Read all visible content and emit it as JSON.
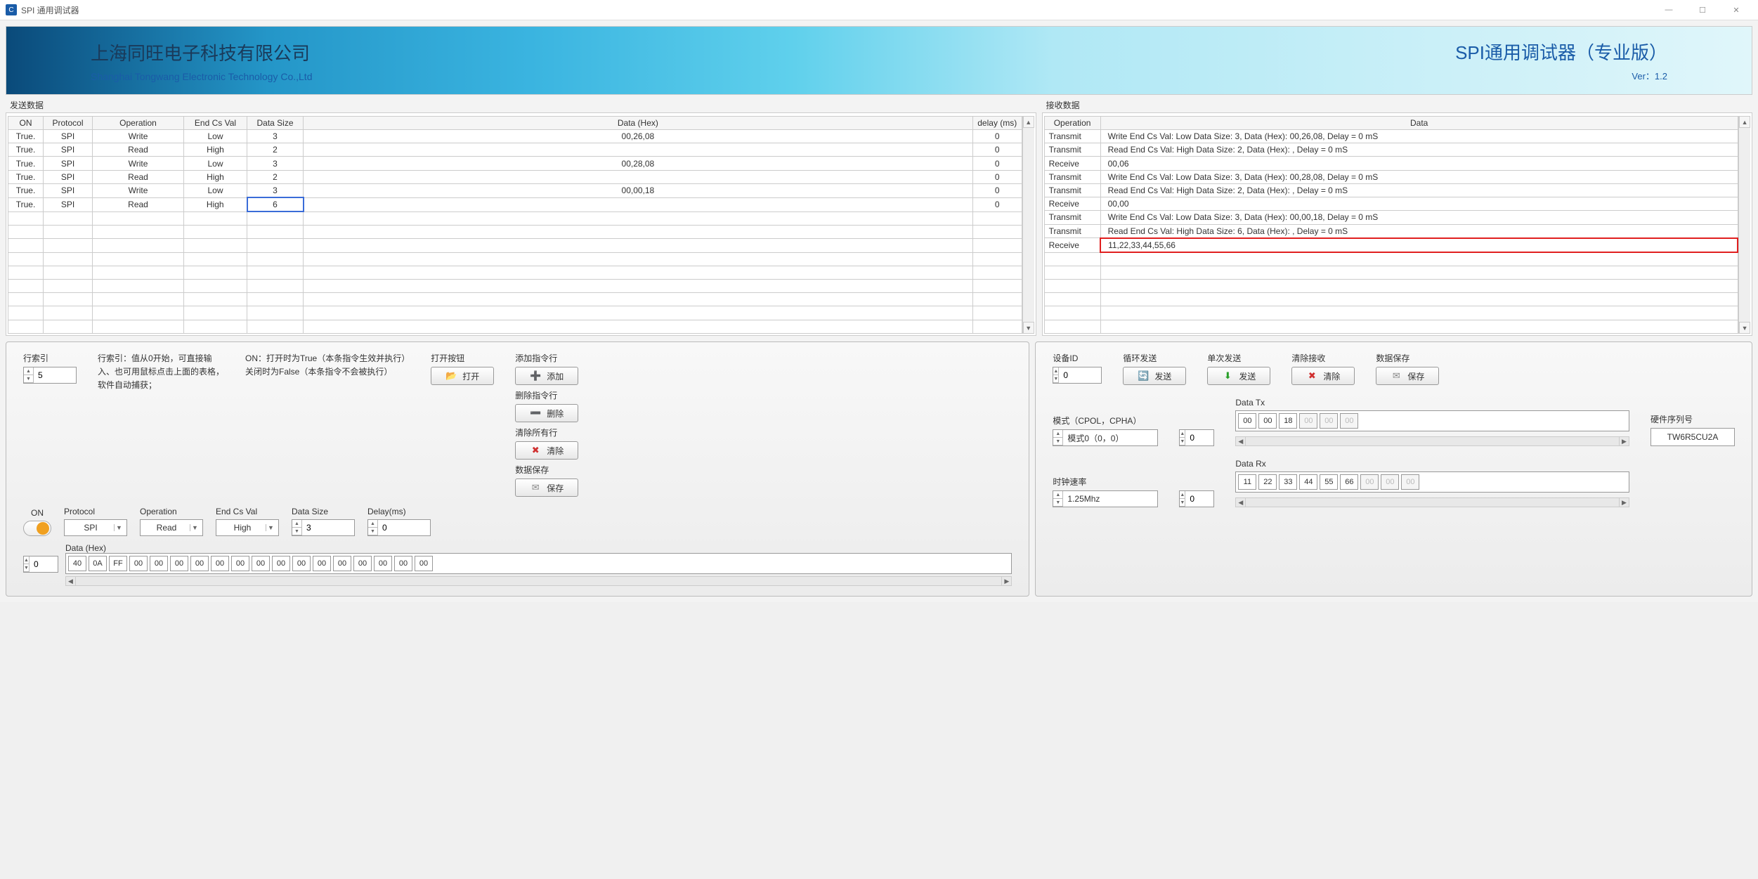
{
  "window": {
    "title": "SPI 通用调试器"
  },
  "banner": {
    "company_cn": "上海同旺电子科技有限公司",
    "company_en": "Shanghai Tongwang Electronic Technology Co.,Ltd",
    "product": "SPI通用调试器（专业版）",
    "version": "Ver：1.2"
  },
  "send": {
    "title": "发送数据",
    "headers": {
      "on": "ON",
      "protocol": "Protocol",
      "operation": "Operation",
      "endcs": "End Cs Val",
      "size": "Data Size",
      "data": "Data (Hex)",
      "delay": "delay (ms)"
    },
    "rows": [
      {
        "on": "True.",
        "protocol": "SPI",
        "operation": "Write",
        "endcs": "Low",
        "size": "3",
        "data": "00,26,08",
        "delay": "0"
      },
      {
        "on": "True.",
        "protocol": "SPI",
        "operation": "Read",
        "endcs": "High",
        "size": "2",
        "data": "",
        "delay": "0"
      },
      {
        "on": "True.",
        "protocol": "SPI",
        "operation": "Write",
        "endcs": "Low",
        "size": "3",
        "data": "00,28,08",
        "delay": "0"
      },
      {
        "on": "True.",
        "protocol": "SPI",
        "operation": "Read",
        "endcs": "High",
        "size": "2",
        "data": "",
        "delay": "0"
      },
      {
        "on": "True.",
        "protocol": "SPI",
        "operation": "Write",
        "endcs": "Low",
        "size": "3",
        "data": "00,00,18",
        "delay": "0"
      },
      {
        "on": "True.",
        "protocol": "SPI",
        "operation": "Read",
        "endcs": "High",
        "size": "6",
        "data": "",
        "delay": "0"
      }
    ],
    "selected_row": 5,
    "selected_col": "size"
  },
  "recv": {
    "title": "接收数据",
    "headers": {
      "operation": "Operation",
      "data": "Data"
    },
    "rows": [
      {
        "op": "Transmit",
        "data": "Write     End Cs Val: Low      Data Size: 3,      Data (Hex): 00,26,08,      Delay = 0 mS"
      },
      {
        "op": "Transmit",
        "data": "Read     End Cs Val: High     Data Size: 2,      Data (Hex): ,      Delay = 0 mS"
      },
      {
        "op": "Receive",
        "data": "00,06"
      },
      {
        "op": "Transmit",
        "data": "Write     End Cs Val: Low      Data Size: 3,      Data (Hex): 00,28,08,      Delay = 0 mS"
      },
      {
        "op": "Transmit",
        "data": "Read     End Cs Val: High     Data Size: 2,      Data (Hex): ,      Delay = 0 mS"
      },
      {
        "op": "Receive",
        "data": "00,00"
      },
      {
        "op": "Transmit",
        "data": "Write     End Cs Val: Low      Data Size: 3,      Data (Hex): 00,00,18,      Delay = 0 mS"
      },
      {
        "op": "Transmit",
        "data": "Read     End Cs Val: High     Data Size: 6,      Data (Hex): ,      Delay = 0 mS"
      },
      {
        "op": "Receive",
        "data": "11,22,33,44,55,66"
      }
    ],
    "highlight_row": 8
  },
  "left_ctrl": {
    "row_index": {
      "label": "行索引",
      "value": "5"
    },
    "help1": "行索引：值从0开始，可直接输入、也可用鼠标点击上面的表格，软件自动捕获；",
    "help2": "ON：打开时为True（本条指令生效并执行）\n关闭时为False（本条指令不会被执行）",
    "on_label": "ON",
    "protocol": {
      "label": "Protocol",
      "value": "SPI"
    },
    "operation": {
      "label": "Operation",
      "value": "Read"
    },
    "endcs": {
      "label": "End Cs Val",
      "value": "High"
    },
    "size": {
      "label": "Data Size",
      "value": "3"
    },
    "delay": {
      "label": "Delay(ms)",
      "value": "0"
    },
    "datahex": {
      "label": "Data (Hex)",
      "spin": "0",
      "bytes": [
        "40",
        "0A",
        "FF",
        "00",
        "00",
        "00",
        "00",
        "00",
        "00",
        "00",
        "00",
        "00",
        "00",
        "00",
        "00",
        "00",
        "00",
        "00"
      ]
    },
    "btns": {
      "open_label": "打开按钮",
      "open": "打开",
      "add_label": "添加指令行",
      "add": "添加",
      "del_label": "删除指令行",
      "del": "删除",
      "clear_label": "清除所有行",
      "clear": "清除",
      "save_label": "数据保存",
      "save": "保存"
    }
  },
  "right_ctrl": {
    "devid": {
      "label": "设备ID",
      "value": "0"
    },
    "loop": {
      "label": "循环发送",
      "btn": "发送"
    },
    "once": {
      "label": "单次发送",
      "btn": "发送"
    },
    "clearrx": {
      "label": "清除接收",
      "btn": "清除"
    },
    "save": {
      "label": "数据保存",
      "btn": "保存"
    },
    "mode": {
      "label": "模式（CPOL，CPHA）",
      "value": "模式0（0，0）"
    },
    "clock": {
      "label": "时钟速率",
      "value": "1.25Mhz"
    },
    "datatx": {
      "label": "Data Tx",
      "spin": "0",
      "bytes": [
        "00",
        "00",
        "18"
      ],
      "dim": [
        "00",
        "00",
        "00"
      ]
    },
    "datarx": {
      "label": "Data Rx",
      "spin": "0",
      "bytes": [
        "11",
        "22",
        "33",
        "44",
        "55",
        "66"
      ],
      "dim": [
        "00",
        "00",
        "00"
      ]
    },
    "hwserial": {
      "label": "硬件序列号",
      "value": "TW6R5CU2A"
    }
  }
}
